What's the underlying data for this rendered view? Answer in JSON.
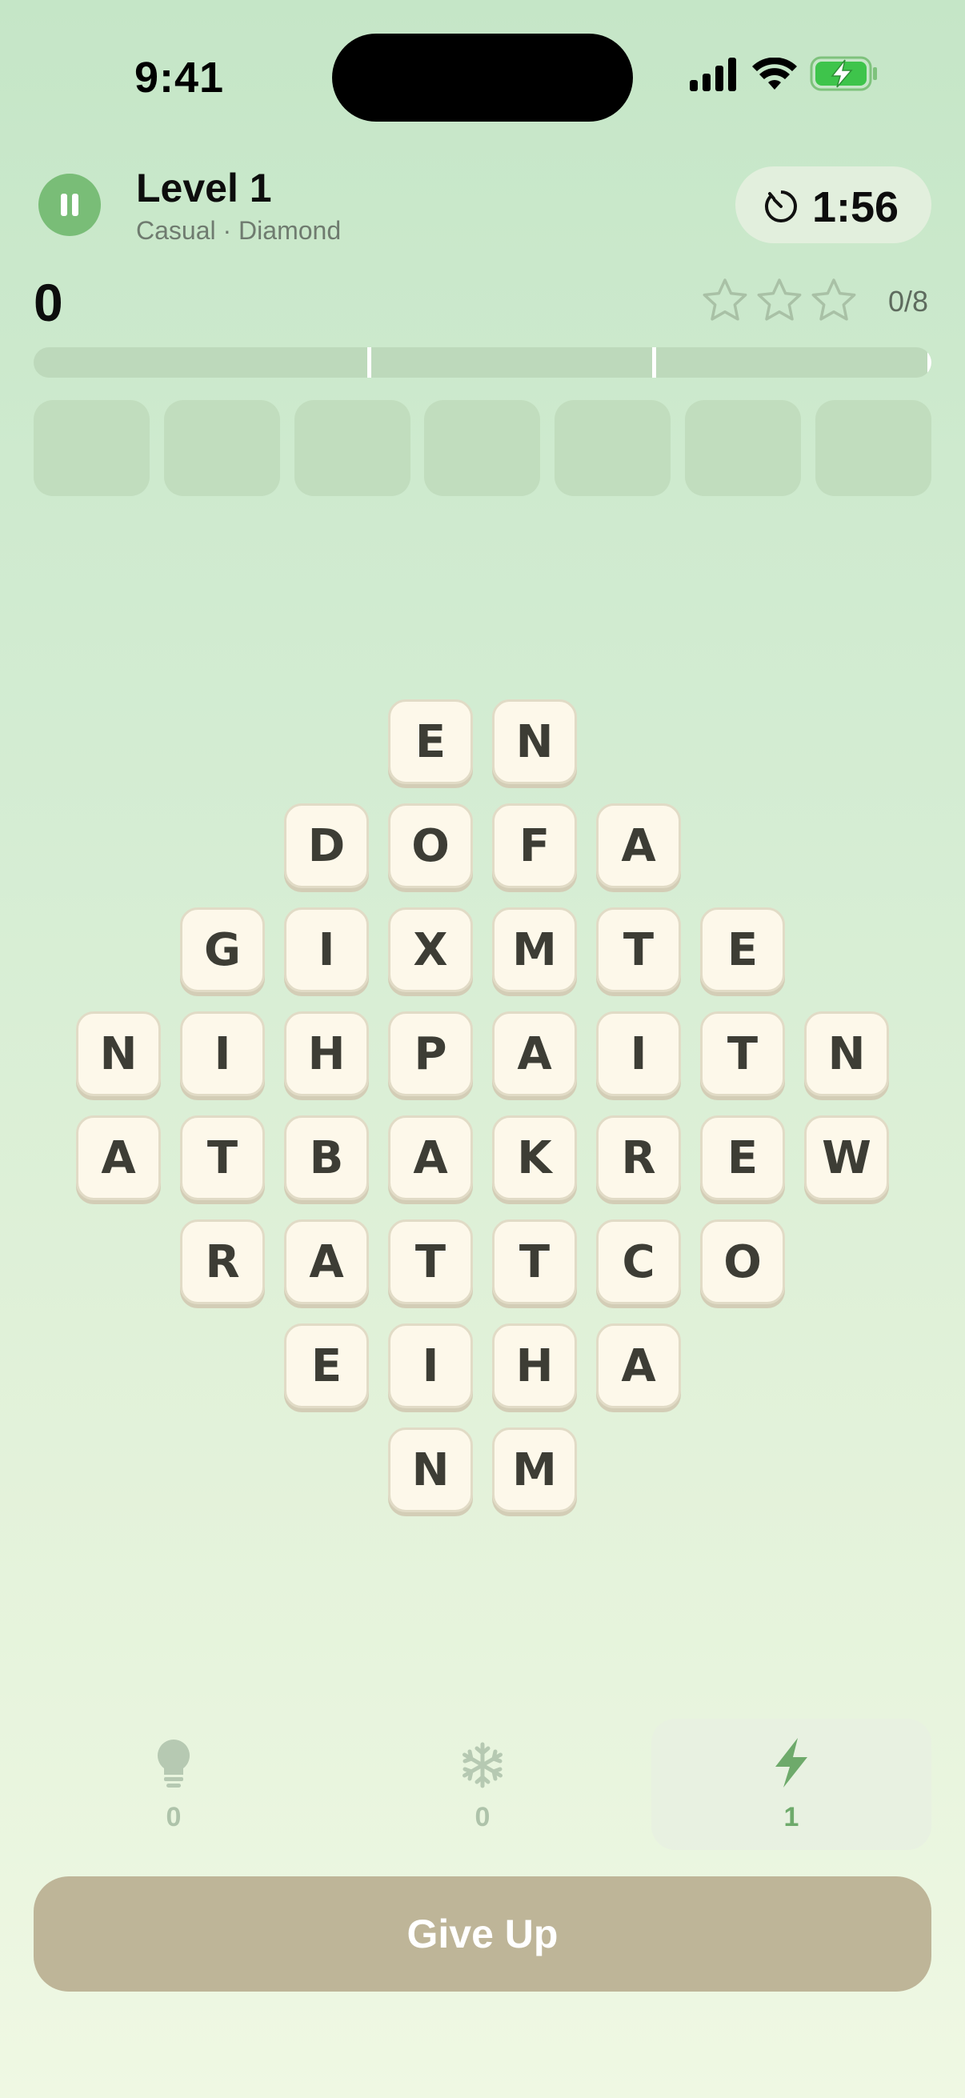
{
  "status_bar": {
    "time": "9:41"
  },
  "header": {
    "level_title": "Level 1",
    "level_subtitle": "Casual · Diamond",
    "timer": "1:56"
  },
  "score": {
    "points": "0",
    "words_found": "0/8",
    "stars_earned": 0,
    "stars_total": 3,
    "progress": 0
  },
  "word_slots": 7,
  "board": {
    "rows": [
      [
        "E",
        "N"
      ],
      [
        "D",
        "O",
        "F",
        "A"
      ],
      [
        "G",
        "I",
        "X",
        "M",
        "T",
        "E"
      ],
      [
        "N",
        "I",
        "H",
        "P",
        "A",
        "I",
        "T",
        "N"
      ],
      [
        "A",
        "T",
        "B",
        "A",
        "K",
        "R",
        "E",
        "W"
      ],
      [
        "R",
        "A",
        "T",
        "T",
        "C",
        "O"
      ],
      [
        "E",
        "I",
        "H",
        "A"
      ],
      [
        "N",
        "M"
      ]
    ]
  },
  "powerups": [
    {
      "name": "hint",
      "icon": "lightbulb-icon",
      "count": "0",
      "active": false
    },
    {
      "name": "freeze",
      "icon": "snowflake-icon",
      "count": "0",
      "active": false
    },
    {
      "name": "boost",
      "icon": "lightning-icon",
      "count": "1",
      "active": true
    }
  ],
  "give_up_label": "Give Up",
  "colors": {
    "accent_green": "#79bd77",
    "tile_bg": "#fdf8ea",
    "give_up_bg": "#beb598"
  }
}
